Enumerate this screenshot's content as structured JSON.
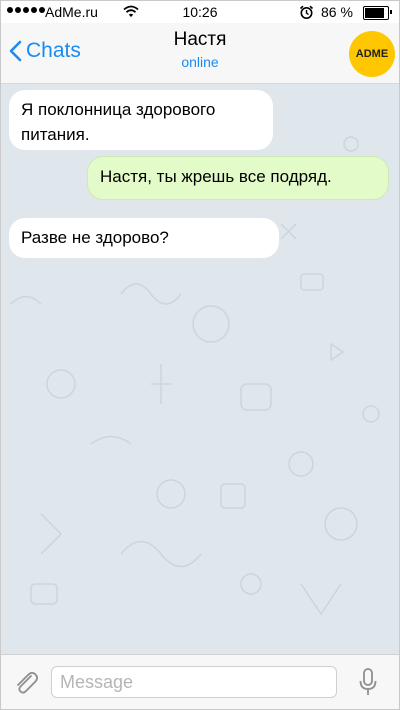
{
  "status_bar": {
    "carrier": "AdMe.ru",
    "time": "10:26",
    "battery_text": "86 %",
    "battery_level": 0.86,
    "icons": [
      "signal-dots-icon",
      "wifi-icon",
      "alarm-icon",
      "battery-icon"
    ]
  },
  "navbar": {
    "back_label": "Chats",
    "title": "Настя",
    "subtitle": "online",
    "avatar_label": "ADME"
  },
  "messages": [
    {
      "direction": "incoming",
      "text": "Я поклонница здорового питания."
    },
    {
      "direction": "outgoing",
      "text": "Настя, ты жрешь все подряд."
    },
    {
      "direction": "incoming",
      "text": "Разве не здорово?"
    }
  ],
  "input_bar": {
    "placeholder": "Message",
    "value": ""
  },
  "colors": {
    "accent": "#1a8cf0",
    "incoming_bubble": "#ffffff",
    "outgoing_bubble": "#e2fbc8",
    "chat_background": "#dfe6ec",
    "avatar": "#ffc700"
  }
}
